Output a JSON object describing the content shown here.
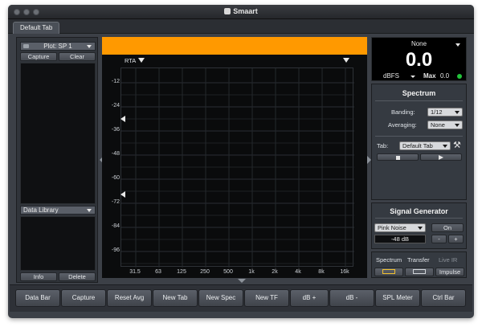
{
  "window": {
    "title": "Smaart"
  },
  "tabs": [
    {
      "label": "Default Tab"
    }
  ],
  "plot_panel": {
    "selector": "Plot: SP 1",
    "capture": "Capture",
    "clear": "Clear",
    "data_library": "Data Library",
    "info": "Info",
    "delete": "Delete"
  },
  "graph": {
    "rta_label": "RTA",
    "y_ticks": [
      "-12",
      "-24",
      "-36",
      "-48",
      "-60",
      "-72",
      "-84",
      "-96"
    ],
    "x_ticks": [
      "31.5",
      "63",
      "125",
      "250",
      "500",
      "1k",
      "2k",
      "4k",
      "8k",
      "16k"
    ]
  },
  "meter": {
    "source": "None",
    "value": "0.0",
    "unit": "dBFS",
    "max_label": "Max",
    "max_value": "0.0",
    "status_color": "#22c33a"
  },
  "spectrum": {
    "title": "Spectrum",
    "banding_label": "Banding:",
    "banding_value": "1/12",
    "averaging_label": "Averaging:",
    "averaging_value": "None",
    "tab_label": "Tab:",
    "tab_value": "Default Tab"
  },
  "signal_generator": {
    "title": "Signal Generator",
    "noise_type": "Pink Noise",
    "level": "-48 dB",
    "on_label": "On",
    "minus": "-",
    "plus": "+"
  },
  "mode_tabs": {
    "spectrum": "Spectrum",
    "transfer": "Transfer",
    "live_ir": "Live IR",
    "impulse": "Impulse"
  },
  "toolbar": {
    "buttons": [
      "Data Bar",
      "Capture",
      "Reset Avg",
      "New Tab",
      "New Spec",
      "New TF",
      "dB +",
      "dB -",
      "SPL Meter",
      "Ctrl Bar"
    ]
  },
  "colors": {
    "accent": "#ff9900"
  }
}
